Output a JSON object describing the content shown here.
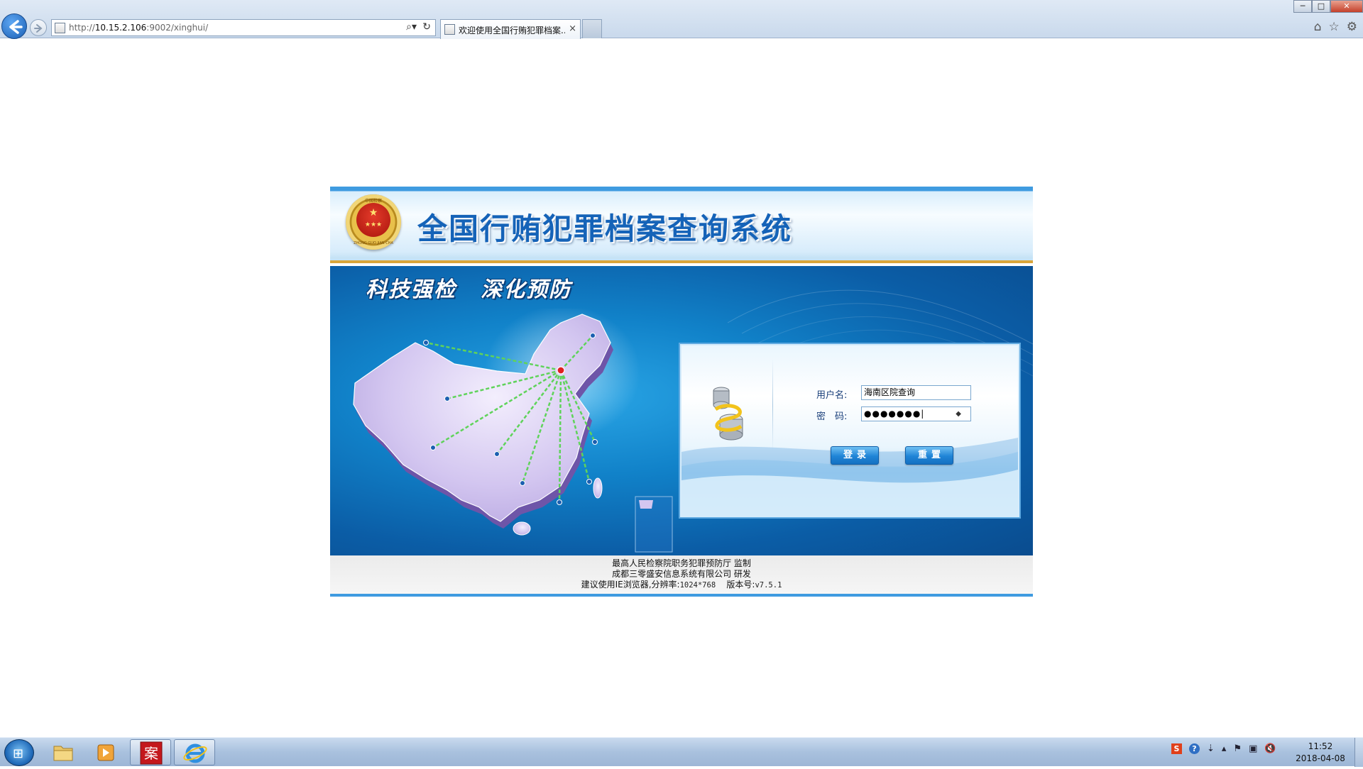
{
  "browser": {
    "url_prefix": "http://",
    "url_host": "10.15.2.106",
    "url_rest": ":9002/xinghui/",
    "tab_title": "欢迎使用全国行贿犯罪档案...",
    "tab_close": "×",
    "window_controls": {
      "minimize": "─",
      "maximize": "□",
      "close": "✕"
    },
    "toolbar_icons": [
      "home-icon",
      "star-icon",
      "gear-icon"
    ]
  },
  "header": {
    "title": "全国行贿犯罪档案查询系统",
    "emblem_center": "★",
    "emblem_top": "中国检察",
    "emblem_bottom": "ZHONG GUO JIAN CHA"
  },
  "banner": {
    "slogan_left": "科技强检",
    "slogan_right": "深化预防"
  },
  "login": {
    "username_label": "用户名:",
    "password_label": "密　码:",
    "username_value": "海南区院查询",
    "password_value": "●●●●●●●|",
    "login_button": "登录",
    "reset_button": "重置"
  },
  "footer": {
    "line1": "最高人民检察院职务犯罪预防厅  监制",
    "line2": "成都三零盛安信息系统有限公司  研发",
    "line3_prefix": "建议使用IE浏览器,分辨率:",
    "line3_resolution": "1024*768",
    "line3_version_label": "版本号:",
    "line3_version": "v7.5.1"
  },
  "taskbar": {
    "clock_time": "11:52",
    "clock_date": "2018-04-08",
    "app_glyph": "案"
  },
  "colors": {
    "header_title": "#1563b8",
    "banner_blue": "#1182c9",
    "accent_gold": "#d9a53a",
    "route_green": "#5fd35a"
  }
}
